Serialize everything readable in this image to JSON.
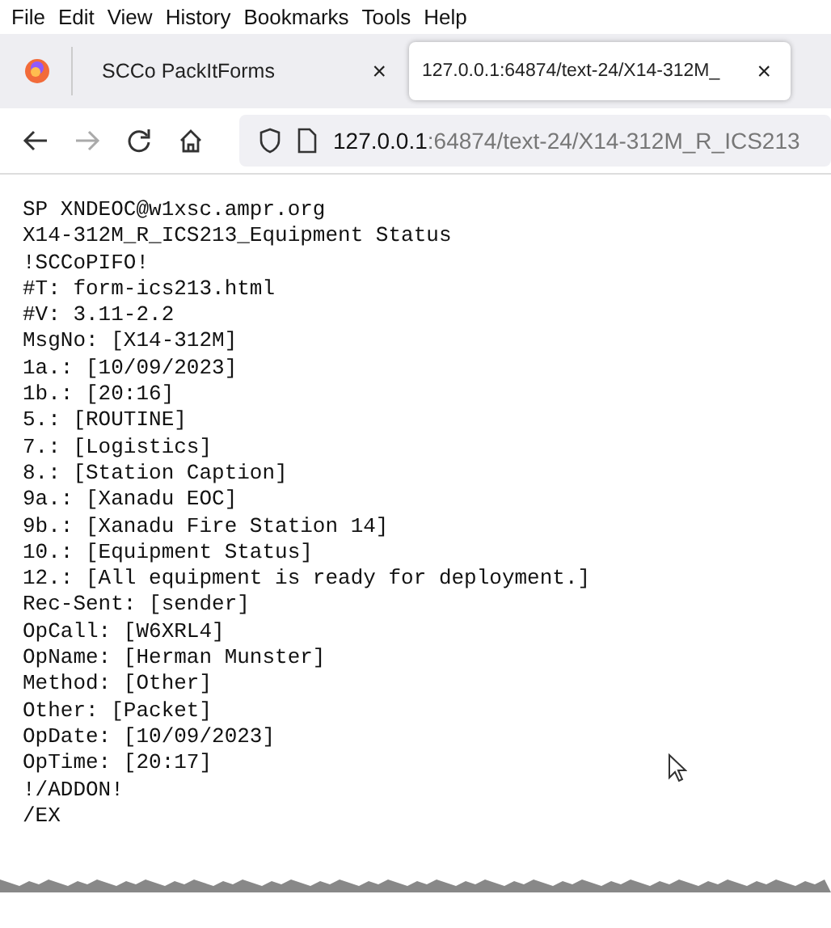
{
  "menu_bar": [
    {
      "label": "File"
    },
    {
      "label": "Edit"
    },
    {
      "label": "View"
    },
    {
      "label": "History"
    },
    {
      "label": "Bookmarks"
    },
    {
      "label": "Tools"
    },
    {
      "label": "Help"
    }
  ],
  "tabs": [
    {
      "label": "SCCo PackItForms",
      "close": "×",
      "selected": false
    },
    {
      "label": "127.0.0.1:64874/text-24/X14-312M_",
      "close": "×",
      "selected": true
    }
  ],
  "address_bar": {
    "host": "127.0.0.1",
    "path": ":64874/text-24/X14-312M_R_ICS213"
  },
  "content_lines": [
    "SP XNDEOC@w1xsc.ampr.org",
    "X14-312M_R_ICS213_Equipment Status",
    "!SCCoPIFO!",
    "#T: form-ics213.html",
    "#V: 3.11-2.2",
    "MsgNo: [X14-312M]",
    "1a.: [10/09/2023]",
    "1b.: [20:16]",
    "5.: [ROUTINE]",
    "7.: [Logistics]",
    "8.: [Station Caption]",
    "9a.: [Xanadu EOC]",
    "9b.: [Xanadu Fire Station 14]",
    "10.: [Equipment Status]",
    "12.: [All equipment is ready for deployment.]",
    "Rec-Sent: [sender]",
    "OpCall: [W6XRL4]",
    "OpName: [Herman Munster]",
    "Method: [Other]",
    "Other: [Packet]",
    "OpDate: [10/09/2023]",
    "OpTime: [20:17]",
    "!/ADDON!",
    "/EX"
  ]
}
